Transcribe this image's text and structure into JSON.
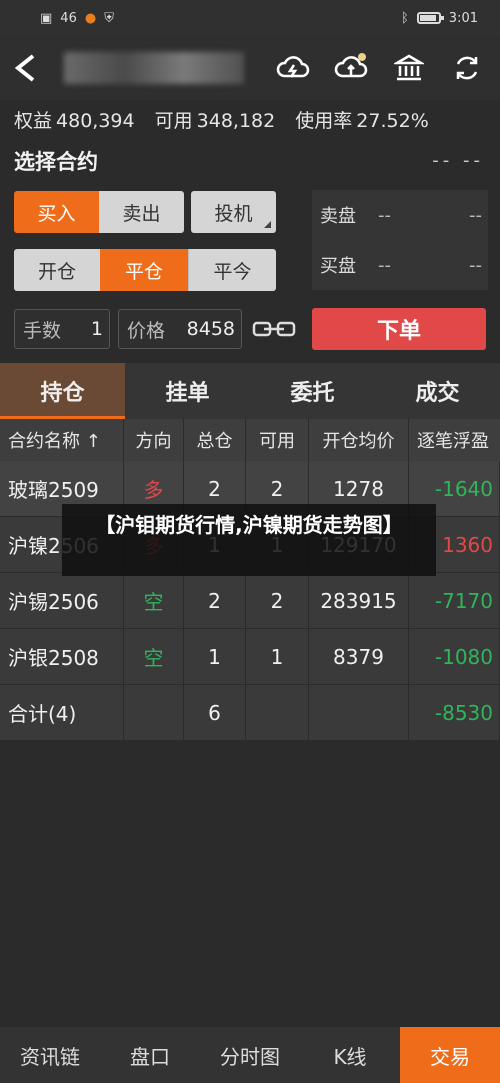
{
  "status": {
    "signal": "46",
    "time": "3:01"
  },
  "header": {
    "back_glyph": "<"
  },
  "account": {
    "equity_label": "权益",
    "equity_value": "480,394",
    "available_label": "可用",
    "available_value": "348,182",
    "usage_label": "使用率",
    "usage_value": "27.52%"
  },
  "contract": {
    "title": "选择合约",
    "code": "-- --"
  },
  "direction": {
    "buy": "买入",
    "sell": "卖出",
    "speculate": "投机"
  },
  "offset": {
    "open": "开仓",
    "close": "平仓",
    "close_today": "平今"
  },
  "book": {
    "ask_label": "卖盘",
    "ask_price": "--",
    "ask_vol": "--",
    "bid_label": "买盘",
    "bid_price": "--",
    "bid_vol": "--"
  },
  "order": {
    "qty_label": "手数",
    "qty_value": "1",
    "price_label": "价格",
    "price_value": "8458",
    "submit_label": "下单"
  },
  "tabs": [
    "持仓",
    "挂单",
    "委托",
    "成交"
  ],
  "table": {
    "headers": [
      "合约名称 ↑",
      "方向",
      "总仓",
      "可用",
      "开仓均价",
      "逐笔浮盈"
    ],
    "rows": [
      [
        "玻璃2509",
        "多",
        "2",
        "2",
        "1278",
        "-1640"
      ],
      [
        "沪镍2506",
        "多",
        "1",
        "1",
        "129170",
        "1360"
      ],
      [
        "沪锡2506",
        "空",
        "2",
        "2",
        "283915",
        "-7170"
      ],
      [
        "沪银2508",
        "空",
        "1",
        "1",
        "8379",
        "-1080"
      ]
    ],
    "total": [
      "合计(4)",
      "",
      "6",
      "",
      "",
      "-8530"
    ]
  },
  "overlay_text": "【沪钼期货行情,沪镍期货走势图】",
  "nav": [
    "资讯链",
    "盘口",
    "分时图",
    "K线",
    "交易"
  ]
}
